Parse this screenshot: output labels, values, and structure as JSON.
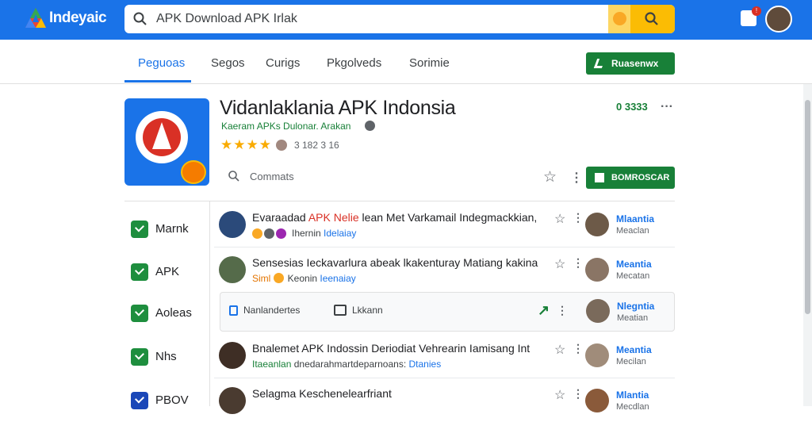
{
  "header": {
    "logo_text": "Indeyaic",
    "search_value": "APK Download APK Irlak"
  },
  "tabs": [
    "Peguoas",
    "Segos",
    "Curigs",
    "Pkgolveds",
    "Sorimie"
  ],
  "top_install_label": "Ruasenwx",
  "app": {
    "title": "Vidanlaklania APK Indonsia",
    "developer": "Kaeram APKs Dulonar. Arakan",
    "stars": "★★★★",
    "rating_count": "3 182 3 16",
    "meta_right": "0 3333",
    "comments_label": "Commats",
    "install_label": "BOMROSCAR"
  },
  "sidebar": {
    "items": [
      {
        "label": "Marnk"
      },
      {
        "label": "APK"
      },
      {
        "label": "Aoleas"
      },
      {
        "label": "Nhs"
      },
      {
        "label": "PBOV"
      }
    ]
  },
  "reviews": [
    {
      "title_red": "APK Nelie",
      "title_a": "Evaraadad ",
      "title_b": " lean Met Varkamail Indegmackkian,",
      "sub_a": "Ihernin ",
      "sub_b": "Idelaiay",
      "reviewer": "Mlaantia",
      "reviewer_sub": "Meaclan"
    },
    {
      "title": "Sensesias Ieckavarlura abeak lkakenturay Matiang kakina",
      "sub_a": "Siml ",
      "sub_b": "Keonin ",
      "sub_c": "Ieenaiay",
      "reviewer": "Meantia",
      "reviewer_sub": "Mecatan"
    },
    {
      "title": "Bnalemet APK Indossin Deriodiat Vehrearin Iamisang Int",
      "sub_a": "Itaeanlan ",
      "sub_b": "dnedarahmartdeparnoans: ",
      "sub_c": "Dtanies",
      "reviewer": "Meantia",
      "reviewer_sub": "Mecilan"
    },
    {
      "title": "Selagma Keschenelearfriant",
      "sub_a": "",
      "sub_b": "",
      "sub_c": "",
      "reviewer": "Mlantia",
      "reviewer_sub": "Mecdlan"
    }
  ],
  "filterbar": {
    "f1": "Nanlandertes",
    "f2": "Lkkann",
    "reviewer": "Nlegntia",
    "reviewer_sub": "Meatian"
  }
}
